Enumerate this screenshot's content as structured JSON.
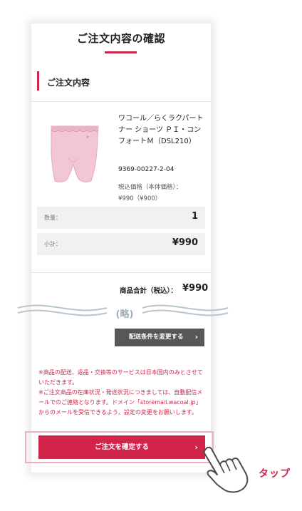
{
  "page": {
    "title": "ご注文内容の確認"
  },
  "section": {
    "title": "ご注文内容"
  },
  "product": {
    "name": "ワコール／らくラクパートナー ショーツ ＰＩ・コンフォートＭ（DSL210）",
    "code": "9369-00227-2-04",
    "price_label": "税込価格（本体価格）：",
    "price": "¥990（¥900）"
  },
  "quantity": {
    "label": "数量：",
    "value": "1"
  },
  "subtotal": {
    "label": "小計：",
    "value": "¥990"
  },
  "total": {
    "label": "商品合計（税込）：",
    "value": "¥990"
  },
  "omit": {
    "label": "(略)"
  },
  "shipping_button": {
    "label": "配送条件を変更する",
    "arrow": "›"
  },
  "notes": [
    "※商品の配送、返品・交換等のサービスは日本国内のみとさせていただきます。",
    "※ご注文商品の在庫状況・発送状況につきましては、自動配信メールでのご連絡となります。ドメイン「storemail.wacoal.jp」からのメールを受信できるよう、設定の変更をお願いします。"
  ],
  "confirm_button": {
    "label": "ご注文を確定する",
    "arrow": "›"
  },
  "annotation": {
    "tap": "タップ"
  },
  "colors": {
    "accent": "#d2244a",
    "gray_button": "#575757",
    "row_bg": "#f1f1f1",
    "highlight": "#ecaec4"
  },
  "icons": {
    "product_image": "pink-shorts-image",
    "hand": "hand-pointer-icon"
  }
}
